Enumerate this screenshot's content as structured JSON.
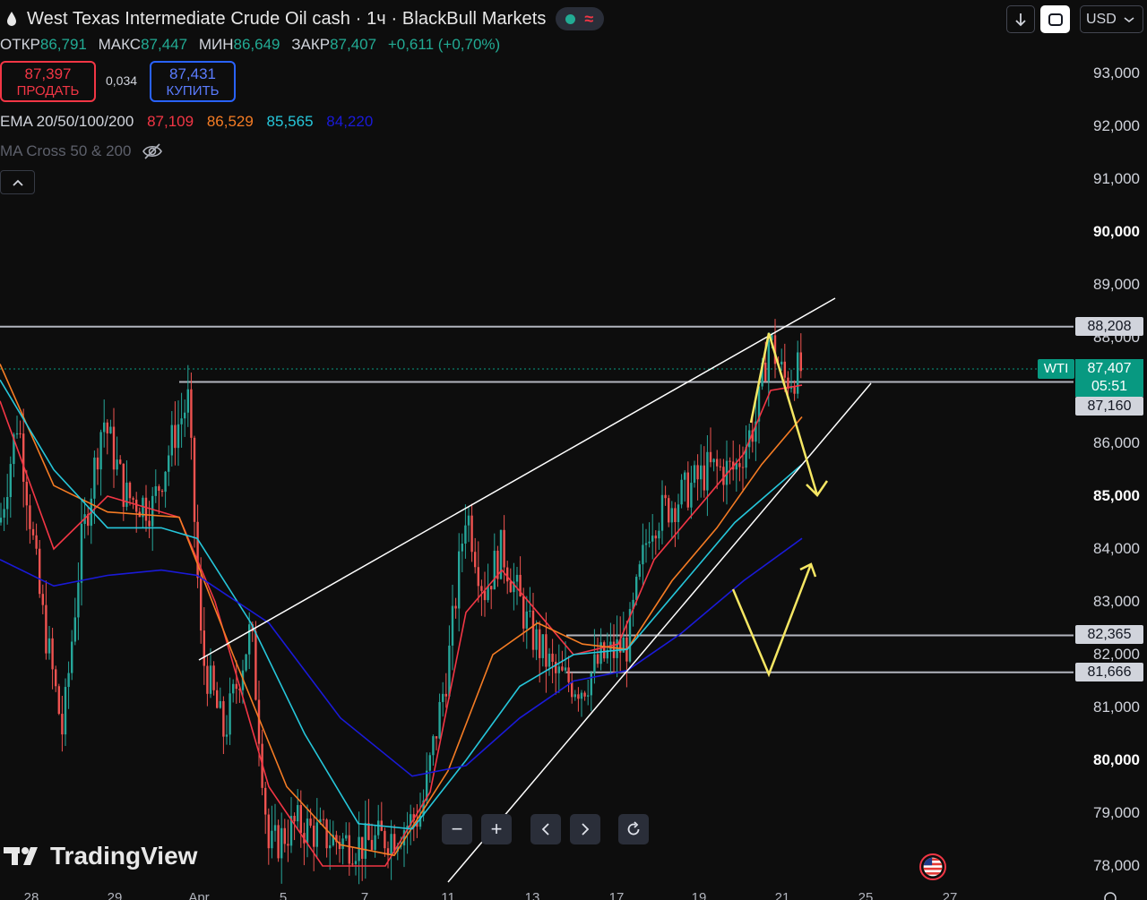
{
  "header": {
    "title": "West Texas Intermediate Crude Oil cash · 1ч · BlackBull Markets",
    "ohlc": [
      {
        "label": "ОТКР",
        "value": "86,791"
      },
      {
        "label": "МАКС",
        "value": "87,447"
      },
      {
        "label": "МИН",
        "value": "86,649"
      },
      {
        "label": "ЗАКР",
        "value": "87,407"
      }
    ],
    "change": "+0,611 (+0,70%)"
  },
  "trade": {
    "sell_price": "87,397",
    "sell_label": "ПРОДАТЬ",
    "spread": "0,034",
    "buy_price": "87,431",
    "buy_label": "КУПИТЬ"
  },
  "indicators": {
    "ema_label": "EMA 20/50/100/200",
    "ema_values": [
      "87,109",
      "86,529",
      "85,565",
      "84,220"
    ],
    "ema_colors": [
      "#f23645",
      "#f57c24",
      "#26c6da",
      "#1a1ad8"
    ],
    "ma_cross_label": "MA Cross 50 & 200"
  },
  "controls": {
    "currency": "USD"
  },
  "price_axis": {
    "ticks": [
      {
        "text": "93,000",
        "value": 93,
        "bold": false
      },
      {
        "text": "92,000",
        "value": 92,
        "bold": false
      },
      {
        "text": "91,000",
        "value": 91,
        "bold": false
      },
      {
        "text": "90,000",
        "value": 90,
        "bold": true
      },
      {
        "text": "89,000",
        "value": 89,
        "bold": false
      },
      {
        "text": "88,000",
        "value": 88,
        "bold": false
      },
      {
        "text": "86,000",
        "value": 86,
        "bold": false
      },
      {
        "text": "85,000",
        "value": 85,
        "bold": true
      },
      {
        "text": "84,000",
        "value": 84,
        "bold": false
      },
      {
        "text": "83,000",
        "value": 83,
        "bold": false
      },
      {
        "text": "82,000",
        "value": 82,
        "bold": false
      },
      {
        "text": "81,000",
        "value": 81,
        "bold": false
      },
      {
        "text": "80,000",
        "value": 80,
        "bold": true
      },
      {
        "text": "79,000",
        "value": 79,
        "bold": false
      },
      {
        "text": "78,000",
        "value": 78,
        "bold": false
      }
    ],
    "level_tags": {
      "resistance": "88,208",
      "support_a": "87,160",
      "support_b": "82,365",
      "support_c": "81,666"
    },
    "last": {
      "symbol": "WTI",
      "price": "87,407",
      "countdown": "05:51"
    }
  },
  "date_axis": [
    "28",
    "29",
    "Apr",
    "5",
    "7",
    "11",
    "13",
    "17",
    "19",
    "21",
    "25",
    "27"
  ],
  "brand": "TradingView",
  "chart_data": {
    "type": "line",
    "title": "West Texas Intermediate Crude Oil cash · 1ч · BlackBull Markets",
    "ylim": [
      77.7,
      93.6
    ],
    "x": [
      "28",
      "29",
      "Apr",
      "5",
      "7",
      "11",
      "13",
      "17",
      "19",
      "21"
    ],
    "series": [
      {
        "name": "EMA 20",
        "color": "#f23645",
        "values": [
          85.5,
          84.8,
          82.5,
          79.5,
          77.9,
          80.5,
          83.5,
          82.7,
          85.2,
          87.1
        ]
      },
      {
        "name": "EMA 50",
        "color": "#f57c24",
        "values": [
          86.2,
          85.0,
          83.5,
          80.5,
          78.3,
          80.0,
          82.5,
          82.3,
          84.5,
          86.5
        ]
      },
      {
        "name": "EMA 100",
        "color": "#26c6da",
        "values": [
          86.8,
          84.6,
          84.3,
          82.0,
          78.5,
          79.2,
          81.3,
          82.0,
          83.8,
          85.6
        ]
      },
      {
        "name": "EMA 200",
        "color": "#1a1ad8",
        "values": [
          83.8,
          83.2,
          83.6,
          82.5,
          79.8,
          79.7,
          80.8,
          81.7,
          82.8,
          84.2
        ]
      }
    ],
    "levels": [
      88.208,
      87.16,
      82.365,
      81.666
    ],
    "last_price": 87.407
  }
}
